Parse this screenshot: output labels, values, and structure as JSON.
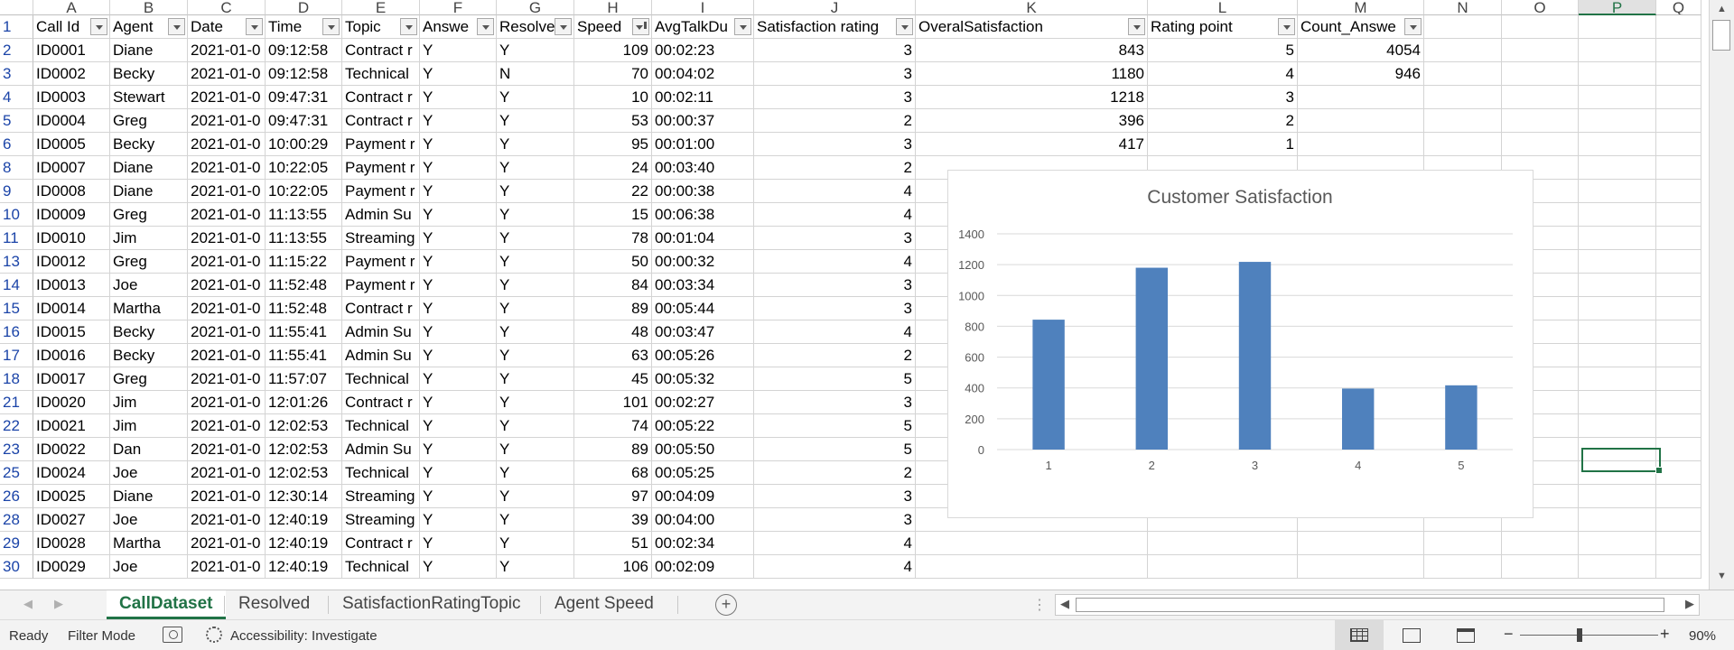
{
  "columns": [
    {
      "letter": "",
      "width": 37
    },
    {
      "letter": "A",
      "width": 85
    },
    {
      "letter": "B",
      "width": 86
    },
    {
      "letter": "C",
      "width": 86
    },
    {
      "letter": "D",
      "width": 85
    },
    {
      "letter": "E",
      "width": 86
    },
    {
      "letter": "F",
      "width": 85
    },
    {
      "letter": "G",
      "width": 86
    },
    {
      "letter": "H",
      "width": 86
    },
    {
      "letter": "I",
      "width": 113
    },
    {
      "letter": "J",
      "width": 179
    },
    {
      "letter": "K",
      "width": 257
    },
    {
      "letter": "L",
      "width": 166
    },
    {
      "letter": "M",
      "width": 140
    },
    {
      "letter": "N",
      "width": 86
    },
    {
      "letter": "O",
      "width": 85
    },
    {
      "letter": "P",
      "width": 86
    },
    {
      "letter": "Q",
      "width": 50
    }
  ],
  "selected_column": "P",
  "header_row": {
    "row_number": "1",
    "cells": [
      "Call Id",
      "Agent",
      "Date",
      "Time",
      "Topic",
      "Answe",
      "Resolve",
      "Speed",
      "AvgTalkDu",
      "Satisfaction rating",
      "OveralSatisfaction",
      "Rating point",
      "Count_Answe",
      "",
      "",
      "",
      ""
    ]
  },
  "rows": [
    {
      "n": "2",
      "cells": [
        "ID0001",
        "Diane",
        "2021-01-0",
        "09:12:58",
        "Contract r",
        "Y",
        "Y",
        "109",
        "00:02:23",
        "3",
        "843",
        "5",
        "4054",
        "",
        "",
        "",
        ""
      ]
    },
    {
      "n": "3",
      "cells": [
        "ID0002",
        "Becky",
        "2021-01-0",
        "09:12:58",
        "Technical",
        "Y",
        "N",
        "70",
        "00:04:02",
        "3",
        "1180",
        "4",
        "946",
        "",
        "",
        "",
        ""
      ]
    },
    {
      "n": "4",
      "cells": [
        "ID0003",
        "Stewart",
        "2021-01-0",
        "09:47:31",
        "Contract r",
        "Y",
        "Y",
        "10",
        "00:02:11",
        "3",
        "1218",
        "3",
        "",
        "",
        "",
        "",
        ""
      ]
    },
    {
      "n": "5",
      "cells": [
        "ID0004",
        "Greg",
        "2021-01-0",
        "09:47:31",
        "Contract r",
        "Y",
        "Y",
        "53",
        "00:00:37",
        "2",
        "396",
        "2",
        "",
        "",
        "",
        "",
        ""
      ]
    },
    {
      "n": "6",
      "cells": [
        "ID0005",
        "Becky",
        "2021-01-0",
        "10:00:29",
        "Payment r",
        "Y",
        "Y",
        "95",
        "00:01:00",
        "3",
        "417",
        "1",
        "",
        "",
        "",
        "",
        ""
      ]
    },
    {
      "n": "8",
      "cells": [
        "ID0007",
        "Diane",
        "2021-01-0",
        "10:22:05",
        "Payment r",
        "Y",
        "Y",
        "24",
        "00:03:40",
        "2",
        "",
        "",
        "",
        "",
        "",
        "",
        ""
      ]
    },
    {
      "n": "9",
      "cells": [
        "ID0008",
        "Diane",
        "2021-01-0",
        "10:22:05",
        "Payment r",
        "Y",
        "Y",
        "22",
        "00:00:38",
        "4",
        "",
        "",
        "",
        "",
        "",
        "",
        ""
      ]
    },
    {
      "n": "10",
      "cells": [
        "ID0009",
        "Greg",
        "2021-01-0",
        "11:13:55",
        "Admin Su",
        "Y",
        "Y",
        "15",
        "00:06:38",
        "4",
        "",
        "",
        "",
        "",
        "",
        "",
        ""
      ]
    },
    {
      "n": "11",
      "cells": [
        "ID0010",
        "Jim",
        "2021-01-0",
        "11:13:55",
        "Streaming",
        "Y",
        "Y",
        "78",
        "00:01:04",
        "3",
        "",
        "",
        "",
        "",
        "",
        "",
        ""
      ]
    },
    {
      "n": "13",
      "cells": [
        "ID0012",
        "Greg",
        "2021-01-0",
        "11:15:22",
        "Payment r",
        "Y",
        "Y",
        "50",
        "00:00:32",
        "4",
        "",
        "",
        "",
        "",
        "",
        "",
        ""
      ]
    },
    {
      "n": "14",
      "cells": [
        "ID0013",
        "Joe",
        "2021-01-0",
        "11:52:48",
        "Payment r",
        "Y",
        "Y",
        "84",
        "00:03:34",
        "3",
        "",
        "",
        "",
        "",
        "",
        "",
        ""
      ]
    },
    {
      "n": "15",
      "cells": [
        "ID0014",
        "Martha",
        "2021-01-0",
        "11:52:48",
        "Contract r",
        "Y",
        "Y",
        "89",
        "00:05:44",
        "3",
        "",
        "",
        "",
        "",
        "",
        "",
        ""
      ]
    },
    {
      "n": "16",
      "cells": [
        "ID0015",
        "Becky",
        "2021-01-0",
        "11:55:41",
        "Admin Su",
        "Y",
        "Y",
        "48",
        "00:03:47",
        "4",
        "",
        "",
        "",
        "",
        "",
        "",
        ""
      ]
    },
    {
      "n": "17",
      "cells": [
        "ID0016",
        "Becky",
        "2021-01-0",
        "11:55:41",
        "Admin Su",
        "Y",
        "Y",
        "63",
        "00:05:26",
        "2",
        "",
        "",
        "",
        "",
        "",
        "",
        ""
      ]
    },
    {
      "n": "18",
      "cells": [
        "ID0017",
        "Greg",
        "2021-01-0",
        "11:57:07",
        "Technical",
        "Y",
        "Y",
        "45",
        "00:05:32",
        "5",
        "",
        "",
        "",
        "",
        "",
        "",
        ""
      ]
    },
    {
      "n": "21",
      "cells": [
        "ID0020",
        "Jim",
        "2021-01-0",
        "12:01:26",
        "Contract r",
        "Y",
        "Y",
        "101",
        "00:02:27",
        "3",
        "",
        "",
        "",
        "",
        "",
        "",
        ""
      ]
    },
    {
      "n": "22",
      "cells": [
        "ID0021",
        "Jim",
        "2021-01-0",
        "12:02:53",
        "Technical",
        "Y",
        "Y",
        "74",
        "00:05:22",
        "5",
        "",
        "",
        "",
        "",
        "",
        "",
        ""
      ]
    },
    {
      "n": "23",
      "cells": [
        "ID0022",
        "Dan",
        "2021-01-0",
        "12:02:53",
        "Admin Su",
        "Y",
        "Y",
        "89",
        "00:05:50",
        "5",
        "",
        "",
        "",
        "",
        "",
        "",
        ""
      ]
    },
    {
      "n": "25",
      "cells": [
        "ID0024",
        "Joe",
        "2021-01-0",
        "12:02:53",
        "Technical",
        "Y",
        "Y",
        "68",
        "00:05:25",
        "2",
        "",
        "",
        "",
        "",
        "",
        "",
        ""
      ]
    },
    {
      "n": "26",
      "cells": [
        "ID0025",
        "Diane",
        "2021-01-0",
        "12:30:14",
        "Streaming",
        "Y",
        "Y",
        "97",
        "00:04:09",
        "3",
        "",
        "",
        "",
        "",
        "",
        "",
        ""
      ]
    },
    {
      "n": "28",
      "cells": [
        "ID0027",
        "Joe",
        "2021-01-0",
        "12:40:19",
        "Streaming",
        "Y",
        "Y",
        "39",
        "00:04:00",
        "3",
        "",
        "",
        "",
        "",
        "",
        "",
        ""
      ]
    },
    {
      "n": "29",
      "cells": [
        "ID0028",
        "Martha",
        "2021-01-0",
        "12:40:19",
        "Contract r",
        "Y",
        "Y",
        "51",
        "00:02:34",
        "4",
        "",
        "",
        "",
        "",
        "",
        "",
        ""
      ]
    },
    {
      "n": "30",
      "cells": [
        "ID0029",
        "Joe",
        "2021-01-0",
        "12:40:19",
        "Technical",
        "Y",
        "Y",
        "106",
        "00:02:09",
        "4",
        "",
        "",
        "",
        "",
        "",
        "",
        ""
      ]
    }
  ],
  "numeric_columns": [
    7,
    9,
    10,
    11,
    12
  ],
  "sheet_tabs": [
    "CallDataset",
    "Resolved",
    "SatisfactionRatingTopic",
    "Agent Speed"
  ],
  "active_tab": "CallDataset",
  "add_sheet_symbol": "+",
  "status": {
    "ready": "Ready",
    "mode": "Filter Mode",
    "accessibility": "Accessibility: Investigate",
    "zoom": "90%",
    "zoom_minus": "−",
    "zoom_plus": "+"
  },
  "colors": {
    "accent": "#217346",
    "bar": "#4f81bd",
    "row_number": "#1b44a8"
  },
  "chart_data": {
    "type": "bar",
    "title": "Customer Satisfaction",
    "categories": [
      "1",
      "2",
      "3",
      "4",
      "5"
    ],
    "values": [
      843,
      1180,
      1218,
      396,
      417
    ],
    "ylim": [
      0,
      1400
    ],
    "yticks": [
      "0",
      "200",
      "400",
      "600",
      "800",
      "1000",
      "1200",
      "1400"
    ],
    "grid": true,
    "legend": "none",
    "xlabel": "",
    "ylabel": ""
  }
}
